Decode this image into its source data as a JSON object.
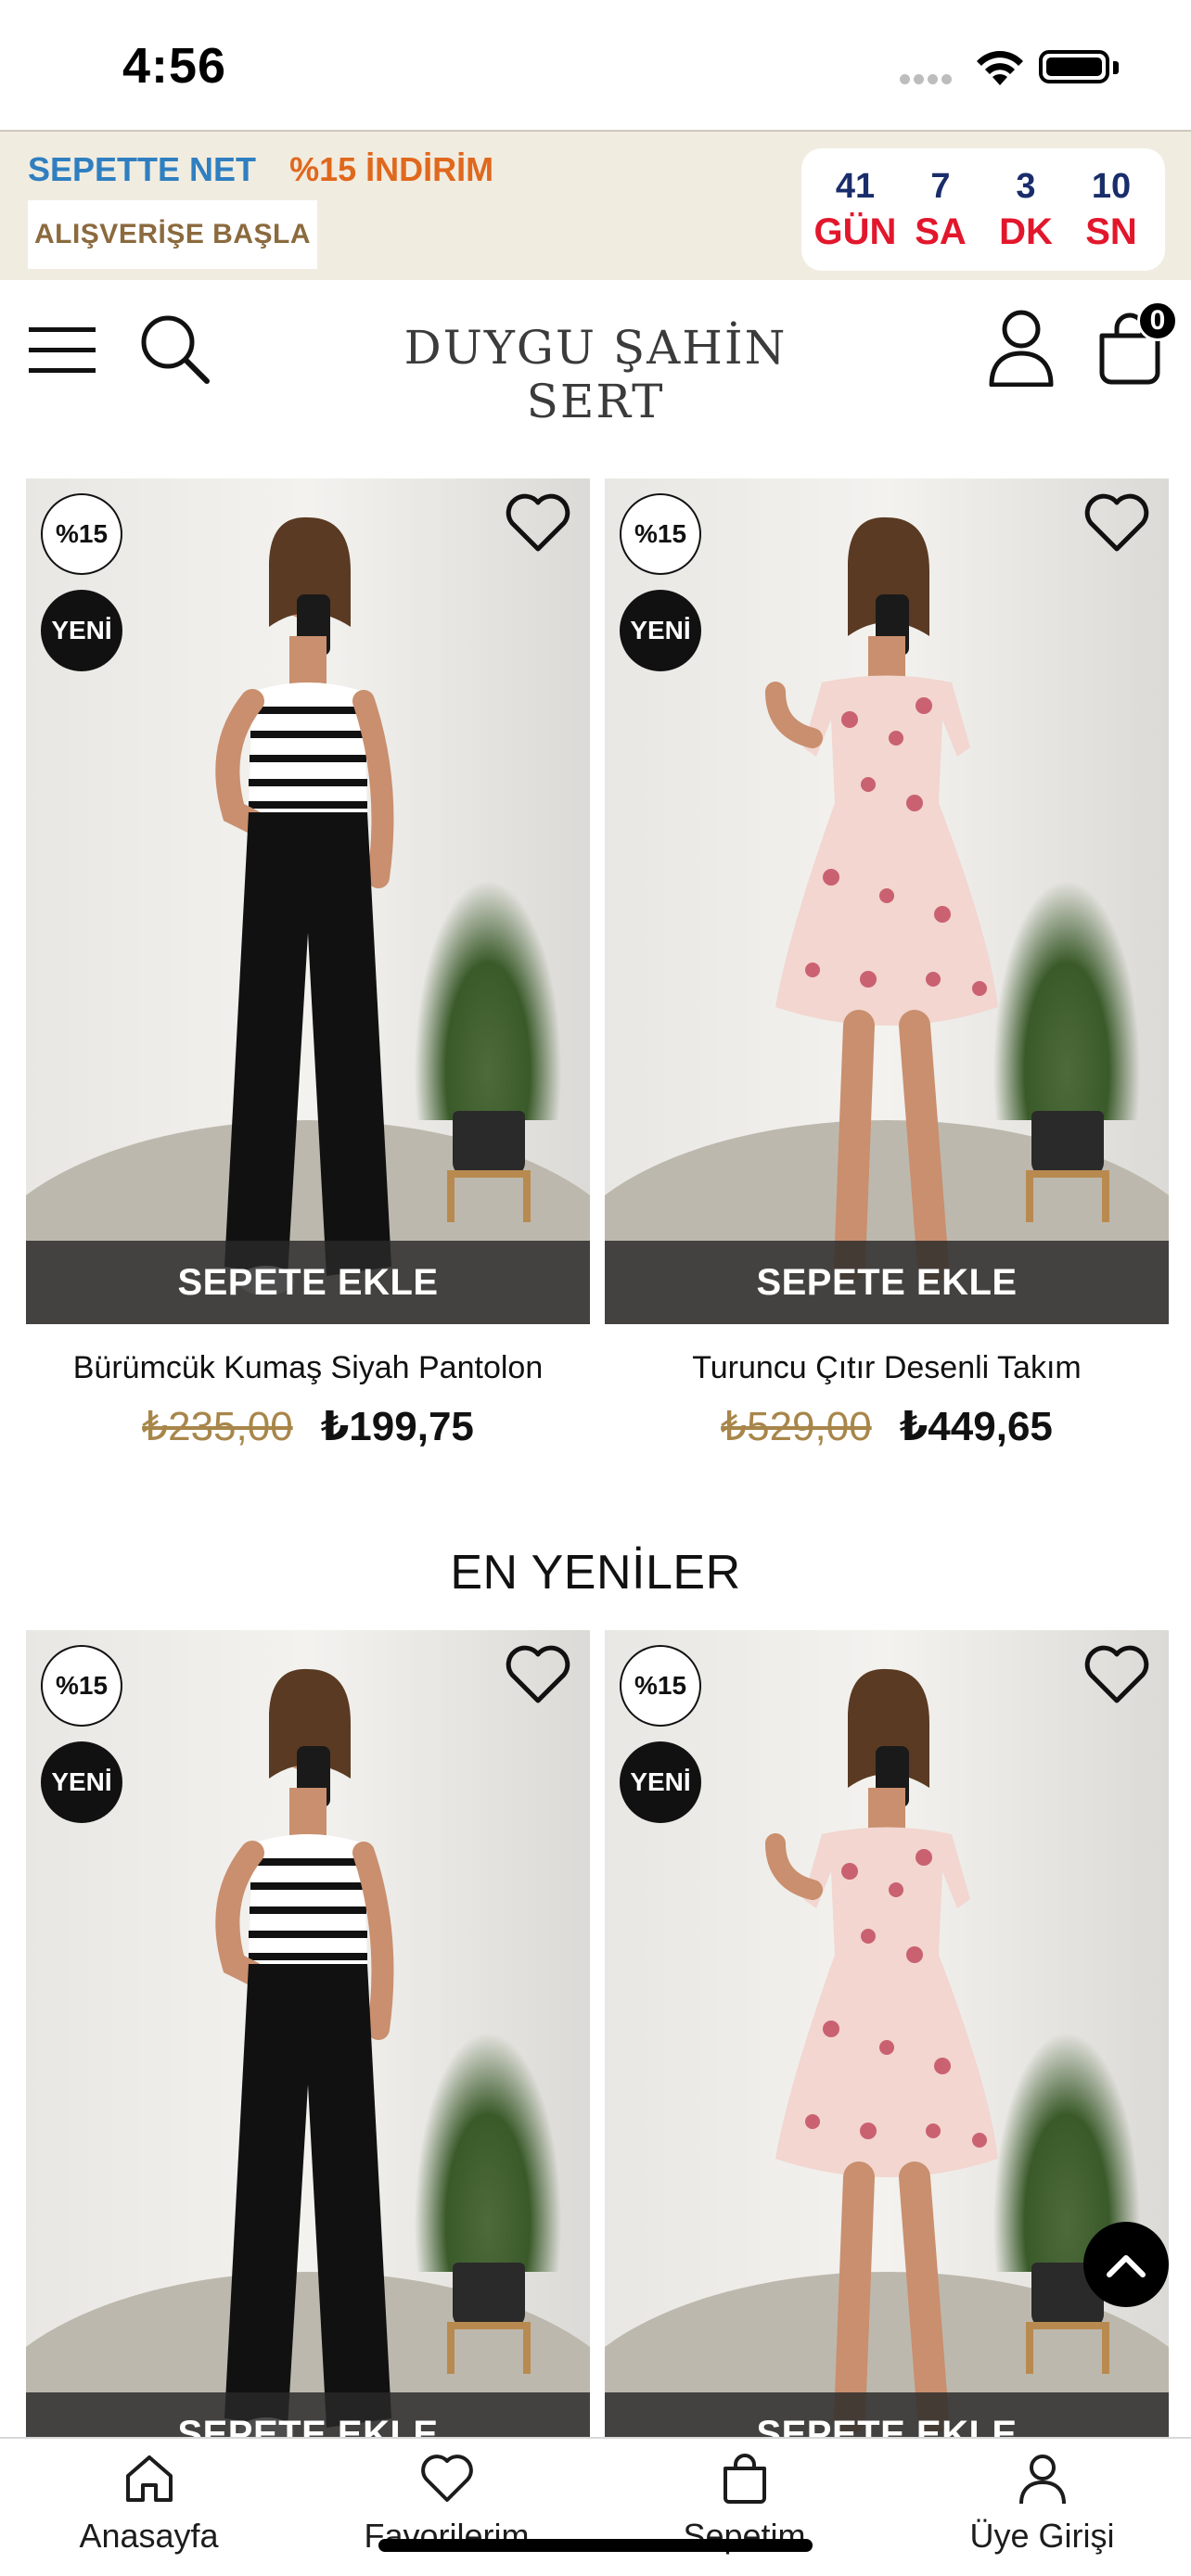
{
  "status_bar": {
    "time": "4:56"
  },
  "promo": {
    "line_blue": "SEPETTE NET",
    "line_orange": "%15 İNDİRİM",
    "shop_button": "ALIŞVERİŞE BAŞLA",
    "countdown": [
      {
        "value": "41",
        "unit": "GÜN"
      },
      {
        "value": "7",
        "unit": "SA"
      },
      {
        "value": "3",
        "unit": "DK"
      },
      {
        "value": "10",
        "unit": "SN"
      }
    ]
  },
  "header": {
    "logo": "DUYGU ŞAHİN SERT",
    "cart_count": "0"
  },
  "products_top": [
    {
      "discount": "%15",
      "badge": "YENİ",
      "add_label": "SEPETE EKLE",
      "name": "Bürümcük Kumaş Siyah Pantolon",
      "old_price": "₺235,00",
      "price": "₺199,75"
    },
    {
      "discount": "%15",
      "badge": "YENİ",
      "add_label": "SEPETE EKLE",
      "name": "Turuncu Çıtır Desenli Takım",
      "old_price": "₺529,00",
      "price": "₺449,65"
    }
  ],
  "section_new": {
    "title": "EN YENİLER"
  },
  "products_new": [
    {
      "discount": "%15",
      "badge": "YENİ",
      "add_label": "SEPETE EKLE"
    },
    {
      "discount": "%15",
      "badge": "YENİ",
      "add_label": "SEPETE EKLE"
    }
  ],
  "tabbar": {
    "items": [
      {
        "label": "Anasayfa",
        "icon": "home-icon"
      },
      {
        "label": "Favorilerim",
        "icon": "heart-icon"
      },
      {
        "label": "Sepetim",
        "icon": "bag-icon"
      },
      {
        "label": "Üye Girişi",
        "icon": "user-icon"
      }
    ]
  },
  "colors": {
    "promo_bg": "#f1ece0",
    "promo_blue": "#2f7fc0",
    "promo_orange": "#e0681d",
    "countdown_number": "#1a2d6b",
    "countdown_unit": "#e2172c",
    "old_price": "#a8864a"
  }
}
